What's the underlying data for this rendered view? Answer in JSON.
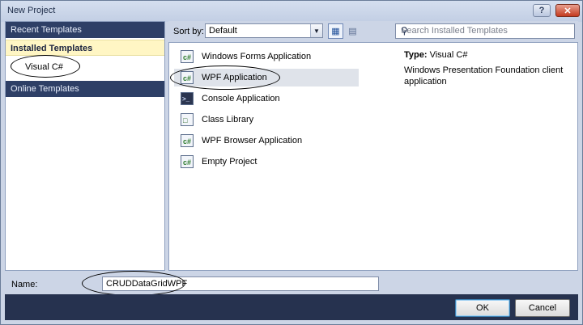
{
  "window": {
    "title": "New Project",
    "help_label": "?",
    "close_label": "✕"
  },
  "categories": {
    "recent": "Recent Templates",
    "installed": "Installed Templates",
    "installed_child": "Visual C#",
    "online": "Online Templates"
  },
  "toolbar": {
    "sort_label": "Sort by:",
    "sort_value": "Default",
    "search_placeholder": "Search Installed Templates"
  },
  "templates": [
    {
      "label": "Windows Forms Application",
      "icon": "winforms-icon"
    },
    {
      "label": "WPF Application",
      "icon": "wpf-icon",
      "selected": true
    },
    {
      "label": "Console Application",
      "icon": "console-icon"
    },
    {
      "label": "Class Library",
      "icon": "class-library-icon"
    },
    {
      "label": "WPF Browser Application",
      "icon": "wpf-browser-icon"
    },
    {
      "label": "Empty Project",
      "icon": "empty-project-icon"
    }
  ],
  "details": {
    "type_label": "Type:",
    "type_value": "Visual C#",
    "description": "Windows Presentation Foundation client application"
  },
  "name_row": {
    "label": "Name:",
    "value": "CRUDDataGridWPF"
  },
  "buttons": {
    "ok": "OK",
    "cancel": "Cancel"
  }
}
